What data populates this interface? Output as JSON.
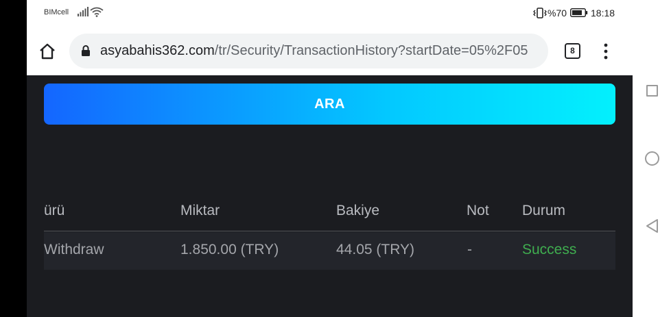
{
  "status_bar": {
    "carrier": "BIMcell",
    "battery": "%70",
    "time": "18:18"
  },
  "browser": {
    "url_domain": "asyabahis362.com",
    "url_path": "/tr/Security/TransactionHistory?startDate=05%2F05",
    "tab_count": "8"
  },
  "page": {
    "search_button": "ARA",
    "table": {
      "headers": [
        "ürü",
        "Miktar",
        "Bakiye",
        "Not",
        "Durum"
      ],
      "rows": [
        [
          "Withdraw",
          "1.850.00 (TRY)",
          "44.05 (TRY)",
          "-",
          "Success"
        ]
      ]
    }
  },
  "colors": {
    "content_bg": "#1b1c20",
    "button_gradient_start": "#1466ff",
    "button_gradient_end": "#03f0fd",
    "success": "#3fad4f"
  },
  "icons": {
    "home": "home-icon",
    "lock": "lock-icon",
    "menu": "more-vert-icon",
    "recents": "square-icon",
    "home_nav": "circle-icon",
    "back": "triangle-back-icon"
  }
}
